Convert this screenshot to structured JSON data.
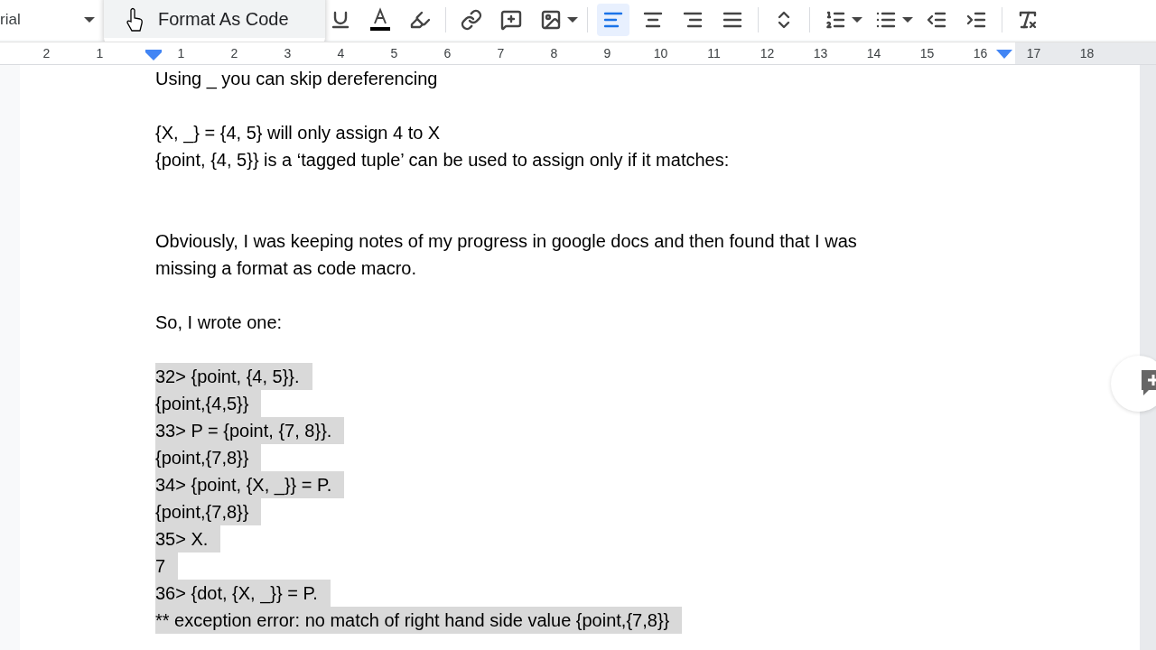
{
  "toolbar": {
    "font": "rial",
    "menu_item": "Format As Code",
    "buttons": [
      {
        "kind": "underline"
      },
      {
        "kind": "text-color"
      },
      {
        "kind": "highlight"
      },
      {
        "kind": "divider"
      },
      {
        "kind": "link"
      },
      {
        "kind": "comment"
      },
      {
        "kind": "image"
      },
      {
        "kind": "caret"
      },
      {
        "kind": "divider"
      },
      {
        "kind": "align-left",
        "selected": true
      },
      {
        "kind": "align-center",
        "selected": false
      },
      {
        "kind": "align-right",
        "selected": false
      },
      {
        "kind": "align-justify",
        "selected": false
      },
      {
        "kind": "divider"
      },
      {
        "kind": "line-spacing"
      },
      {
        "kind": "divider"
      },
      {
        "kind": "numbered-list"
      },
      {
        "kind": "caret"
      },
      {
        "kind": "bulleted-list"
      },
      {
        "kind": "caret"
      },
      {
        "kind": "outdent"
      },
      {
        "kind": "indent"
      },
      {
        "kind": "divider"
      },
      {
        "kind": "clear-format"
      }
    ]
  },
  "ruler": {
    "left_labels": [
      "2",
      "1"
    ],
    "labels": [
      "1",
      "2",
      "3",
      "4",
      "5",
      "6",
      "7",
      "8",
      "9",
      "10",
      "11",
      "12",
      "13",
      "14",
      "15",
      "16",
      "17",
      "18"
    ]
  },
  "document": {
    "lines": [
      {
        "kind": "text",
        "text": "Using _ you can skip dereferencing"
      },
      {
        "kind": "blank"
      },
      {
        "kind": "text",
        "text": "{X, _} = {4, 5} will only assign 4 to X"
      },
      {
        "kind": "text",
        "text": "{point, {4, 5}} is a ‘tagged tuple’ can be used to assign only if it matches:"
      },
      {
        "kind": "blank"
      },
      {
        "kind": "blank"
      },
      {
        "kind": "text",
        "text": "Obviously, I was keeping notes of my progress in google docs and then found that I was"
      },
      {
        "kind": "text",
        "text": "missing a format as code macro."
      },
      {
        "kind": "blank"
      },
      {
        "kind": "text",
        "text": "So, I wrote one:"
      },
      {
        "kind": "blank"
      },
      {
        "kind": "code",
        "text": "32> {point, {4, 5}}."
      },
      {
        "kind": "code",
        "text": "{point,{4,5}}"
      },
      {
        "kind": "code",
        "text": "33> P = {point, {7, 8}}."
      },
      {
        "kind": "code",
        "text": "{point,{7,8}}"
      },
      {
        "kind": "code",
        "text": "34> {point, {X, _}} = P."
      },
      {
        "kind": "code",
        "text": "{point,{7,8}}"
      },
      {
        "kind": "code",
        "text": "35> X."
      },
      {
        "kind": "code",
        "text": "7"
      },
      {
        "kind": "code",
        "text": "36> {dot, {X, _}} = P."
      },
      {
        "kind": "code",
        "text": "** exception error: no match of right hand side value {point,{7,8}}"
      }
    ]
  }
}
